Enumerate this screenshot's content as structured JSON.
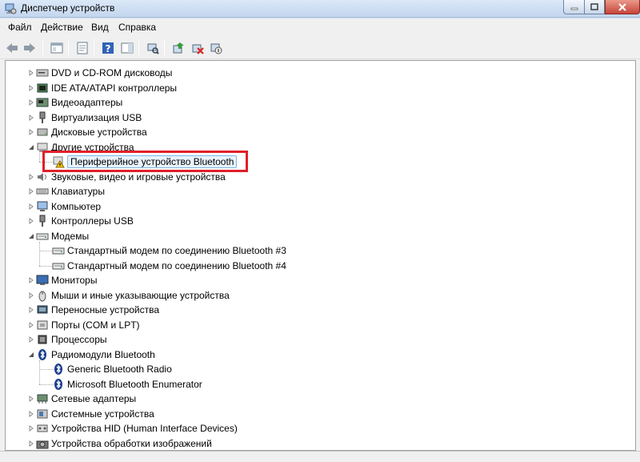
{
  "window": {
    "title": "Диспетчер устройств"
  },
  "menu": [
    "Файл",
    "Действие",
    "Вид",
    "Справка"
  ],
  "toolbar": {
    "icons": [
      "back-arrow-icon",
      "forward-arrow-icon",
      "show-hide-tree-icon",
      "properties-icon",
      "help-icon",
      "action-pane-icon",
      "scan-hardware-icon",
      "update-driver-icon",
      "uninstall-icon",
      "disable-icon"
    ]
  },
  "tree": {
    "items": [
      {
        "label": "DVD и CD-ROM дисководы",
        "icon": "dvd-drive-icon",
        "level": 0,
        "state": "collapsed"
      },
      {
        "label": "IDE ATA/ATAPI контроллеры",
        "icon": "ide-controller-icon",
        "level": 0,
        "state": "collapsed"
      },
      {
        "label": "Видеоадаптеры",
        "icon": "display-adapter-icon",
        "level": 0,
        "state": "collapsed"
      },
      {
        "label": "Виртуализация USB",
        "icon": "usb-icon",
        "level": 0,
        "state": "collapsed"
      },
      {
        "label": "Дисковые устройства",
        "icon": "disk-drive-icon",
        "level": 0,
        "state": "collapsed"
      },
      {
        "label": "Другие устройства",
        "icon": "other-devices-icon",
        "level": 0,
        "state": "expanded"
      },
      {
        "label": "Периферийное устройство Bluetooth",
        "icon": "warning-device-icon",
        "level": 1,
        "state": "leaf",
        "selected": true
      },
      {
        "label": "Звуковые, видео и игровые устройства",
        "icon": "sound-icon",
        "level": 0,
        "state": "collapsed"
      },
      {
        "label": "Клавиатуры",
        "icon": "keyboard-icon",
        "level": 0,
        "state": "collapsed"
      },
      {
        "label": "Компьютер",
        "icon": "computer-icon",
        "level": 0,
        "state": "collapsed"
      },
      {
        "label": "Контроллеры USB",
        "icon": "usb-controller-icon",
        "level": 0,
        "state": "collapsed"
      },
      {
        "label": "Модемы",
        "icon": "modem-icon",
        "level": 0,
        "state": "expanded"
      },
      {
        "label": "Стандартный модем по соединению Bluetooth #3",
        "icon": "modem-icon",
        "level": 1,
        "state": "leaf"
      },
      {
        "label": "Стандартный модем по соединению Bluetooth #4",
        "icon": "modem-icon",
        "level": 1,
        "state": "leaf"
      },
      {
        "label": "Мониторы",
        "icon": "monitor-icon",
        "level": 0,
        "state": "collapsed"
      },
      {
        "label": "Мыши и иные указывающие устройства",
        "icon": "mouse-icon",
        "level": 0,
        "state": "collapsed"
      },
      {
        "label": "Переносные устройства",
        "icon": "portable-device-icon",
        "level": 0,
        "state": "collapsed"
      },
      {
        "label": "Порты (COM и LPT)",
        "icon": "port-icon",
        "level": 0,
        "state": "collapsed"
      },
      {
        "label": "Процессоры",
        "icon": "processor-icon",
        "level": 0,
        "state": "collapsed"
      },
      {
        "label": "Радиомодули Bluetooth",
        "icon": "bluetooth-icon",
        "level": 0,
        "state": "expanded"
      },
      {
        "label": "Generic Bluetooth Radio",
        "icon": "bluetooth-icon",
        "level": 1,
        "state": "leaf"
      },
      {
        "label": "Microsoft Bluetooth Enumerator",
        "icon": "bluetooth-icon",
        "level": 1,
        "state": "leaf"
      },
      {
        "label": "Сетевые адаптеры",
        "icon": "network-adapter-icon",
        "level": 0,
        "state": "collapsed"
      },
      {
        "label": "Системные устройства",
        "icon": "system-device-icon",
        "level": 0,
        "state": "collapsed"
      },
      {
        "label": "Устройства HID (Human Interface Devices)",
        "icon": "hid-icon",
        "level": 0,
        "state": "collapsed"
      },
      {
        "label": "Устройства обработки изображений",
        "icon": "imaging-device-icon",
        "level": 0,
        "state": "collapsed"
      }
    ]
  },
  "colors": {
    "highlight": "#e0202a",
    "selection": "#e8f3fd",
    "titlebar": "#c3d6ee"
  }
}
